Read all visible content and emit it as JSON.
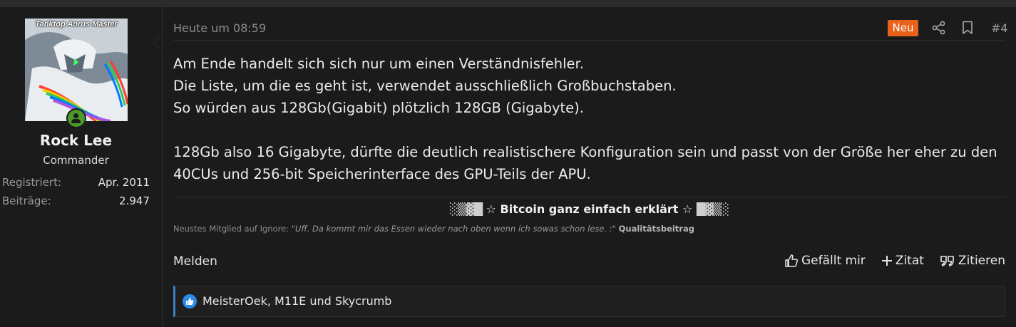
{
  "user": {
    "avatar_caption": "Tanktop Aorus Master",
    "name": "Rock Lee",
    "title": "Commander",
    "stats": [
      {
        "label": "Registriert:",
        "value": "Apr. 2011"
      },
      {
        "label": "Beiträge:",
        "value": "2.947"
      }
    ]
  },
  "post": {
    "time": "Heute um 08:59",
    "badge": "Neu",
    "number": "#4",
    "paragraphs": [
      "Am Ende handelt sich sich nur um einen Verständnisfehler.",
      "Die Liste, um die es geht ist, verwendet ausschließlich Großbuchstaben.",
      "So würden aus 128Gb(Gigabit) plötzlich 128GB (Gigabyte).",
      "128Gb also 16 Gigabyte, dürfte die deutlich realistischere Konfiguration sein und passt von der Größe her eher zu den 40CUs und 256-bit Speicherinterface des GPU-Teils der APU."
    ]
  },
  "signature": {
    "left_blocks": "░▒▓█",
    "title": "☆ Bitcoin ganz einfach erklärt ☆",
    "right_blocks": "█▓▒░",
    "sub_prefix": "Neustes Mitglied auf Ignore:",
    "sub_quote": "\"Uff. Da kommt mir das Essen wieder nach oben wenn ich sowas schon lese. :\"",
    "sub_suffix": "Qualitätsbeitrag"
  },
  "footer": {
    "report": "Melden",
    "like": "Gefällt mir",
    "quote": "Zitat",
    "reply": "Zitieren"
  },
  "likes": {
    "text": "MeisterOek, M11E und Skycrumb"
  },
  "colors": {
    "badge": "#e8621c",
    "online": "#4c9a2a",
    "like_bar": "#3b82c4"
  }
}
